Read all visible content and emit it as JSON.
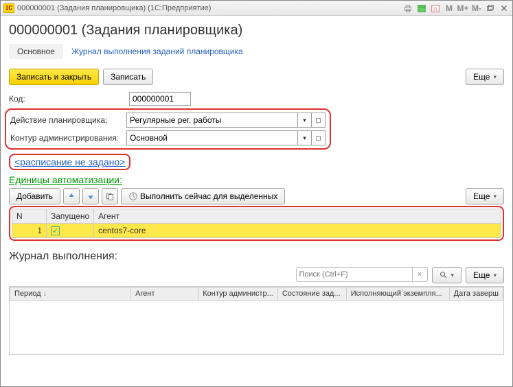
{
  "titlebar": {
    "logo": "1С",
    "text": "000000001 (Задания планировщика)  (1С:Предприятие)",
    "m1": "M",
    "m2": "M+",
    "m3": "M-"
  },
  "page_title": "000000001 (Задания планировщика)",
  "nav": {
    "tab1": "Основное",
    "tab2": "Журнал выполнения заданий планировщика"
  },
  "toolbar": {
    "save_close": "Записать и закрыть",
    "save": "Записать",
    "more": "Еще"
  },
  "form": {
    "code_label": "Код:",
    "code_value": "000000001",
    "action_label": "Действие планировщика:",
    "action_value": "Регулярные рег. работы",
    "contour_label": "Контур администрирования:",
    "contour_value": "Основной"
  },
  "schedule_link": "<расписание не задано>",
  "units": {
    "title": "Единицы автоматизации:",
    "add": "Добавить",
    "run": "Выполнить сейчас для выделенных",
    "more": "Еще",
    "cols": {
      "n": "N",
      "started": "Запущено",
      "agent": "Агент"
    },
    "rows": [
      {
        "n": "1",
        "started": true,
        "agent": "centos7-core"
      }
    ]
  },
  "journal": {
    "title": "Журнал выполнения:",
    "search_placeholder": "Поиск (Ctrl+F)",
    "more": "Еще",
    "cols": {
      "period": "Период",
      "agent": "Агент",
      "contour": "Контур администр...",
      "state": "Состояние зад...",
      "executor": "Исполняющий экземпля...",
      "end": "Дата заверш"
    }
  }
}
